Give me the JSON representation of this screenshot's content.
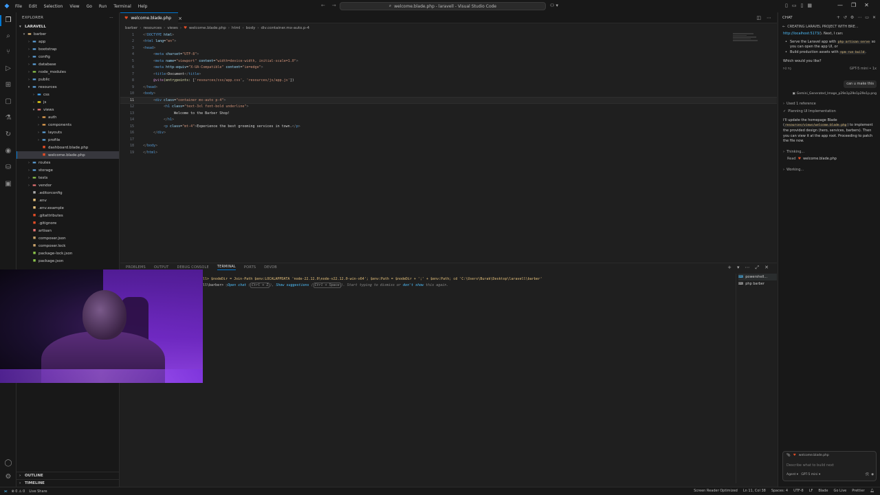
{
  "titlebar": {
    "menu": [
      "File",
      "Edit",
      "Selection",
      "View",
      "Go",
      "Run",
      "Terminal",
      "Help"
    ],
    "search_text": "welcome.blade.php - laravell - Visual Studio Code"
  },
  "explorer": {
    "header": "EXPLORER",
    "section": "LARAVELL",
    "items": [
      {
        "label": "barber",
        "depth": 1,
        "type": "folder-open",
        "icon_color": "#dcb67a"
      },
      {
        "label": "app",
        "depth": 2,
        "type": "folder",
        "icon_color": "#5ca0d8"
      },
      {
        "label": "bootstrap",
        "depth": 2,
        "type": "folder",
        "icon_color": "#5ca0d8"
      },
      {
        "label": "config",
        "depth": 2,
        "type": "folder",
        "icon_color": "#5ca0d8"
      },
      {
        "label": "database",
        "depth": 2,
        "type": "folder",
        "icon_color": "#5ca0d8"
      },
      {
        "label": "node_modules",
        "depth": 2,
        "type": "folder",
        "icon_color": "#8bc34a"
      },
      {
        "label": "public",
        "depth": 2,
        "type": "folder",
        "icon_color": "#5ca0d8"
      },
      {
        "label": "resources",
        "depth": 2,
        "type": "folder-open",
        "icon_color": "#5ca0d8"
      },
      {
        "label": "css",
        "depth": 3,
        "type": "folder",
        "icon_color": "#42a5f5"
      },
      {
        "label": "js",
        "depth": 3,
        "type": "folder",
        "icon_color": "#f5de19"
      },
      {
        "label": "views",
        "depth": 3,
        "type": "folder-open",
        "icon_color": "#e57373"
      },
      {
        "label": "auth",
        "depth": 4,
        "type": "folder",
        "icon_color": "#e5a050"
      },
      {
        "label": "components",
        "depth": 4,
        "type": "folder",
        "icon_color": "#e5a050"
      },
      {
        "label": "layouts",
        "depth": 4,
        "type": "folder",
        "icon_color": "#5ca0d8"
      },
      {
        "label": "profile",
        "depth": 4,
        "type": "folder",
        "icon_color": "#5ca0d8"
      },
      {
        "label": "dashboard.blade.php",
        "depth": 4,
        "type": "file",
        "icon_color": "#e44d26"
      },
      {
        "label": "welcome.blade.php",
        "depth": 4,
        "type": "file",
        "icon_color": "#e44d26",
        "selected": true
      },
      {
        "label": "routes",
        "depth": 2,
        "type": "folder",
        "icon_color": "#5ca0d8"
      },
      {
        "label": "storage",
        "depth": 2,
        "type": "folder",
        "icon_color": "#5ca0d8"
      },
      {
        "label": "tests",
        "depth": 2,
        "type": "folder",
        "icon_color": "#8bc34a"
      },
      {
        "label": "vendor",
        "depth": 2,
        "type": "folder",
        "icon_color": "#e57373"
      },
      {
        "label": ".editorconfig",
        "depth": 2,
        "type": "file",
        "icon_color": "#aaaaaa"
      },
      {
        "label": ".env",
        "depth": 2,
        "type": "file",
        "icon_color": "#e5c07b"
      },
      {
        "label": ".env.example",
        "depth": 2,
        "type": "file",
        "icon_color": "#e5c07b"
      },
      {
        "label": ".gitattributes",
        "depth": 2,
        "type": "file",
        "icon_color": "#e44d26"
      },
      {
        "label": ".gitignore",
        "depth": 2,
        "type": "file",
        "icon_color": "#e44d26"
      },
      {
        "label": "artisan",
        "depth": 2,
        "type": "file",
        "icon_color": "#e57373"
      },
      {
        "label": "composer.json",
        "depth": 2,
        "type": "file",
        "icon_color": "#c9a36b"
      },
      {
        "label": "composer.lock",
        "depth": 2,
        "type": "file",
        "icon_color": "#c9a36b"
      },
      {
        "label": "package-lock.json",
        "depth": 2,
        "type": "file",
        "icon_color": "#8bc34a"
      },
      {
        "label": "package.json",
        "depth": 2,
        "type": "file",
        "icon_color": "#8bc34a"
      }
    ],
    "outline": "OUTLINE",
    "timeline": "TIMELINE"
  },
  "tab": {
    "label": "welcome.blade.php"
  },
  "breadcrumb": [
    "barber",
    "resources",
    "views",
    "welcome.blade.php",
    "html",
    "body",
    "div.container.mx-auto.p-4"
  ],
  "code": [
    {
      "n": "1",
      "indent": 0,
      "parts": [
        [
          "punct",
          "<!"
        ],
        [
          "tag",
          "DOCTYPE"
        ],
        [
          "attr",
          " html"
        ],
        [
          "punct",
          ">"
        ]
      ]
    },
    {
      "n": "2",
      "indent": 0,
      "parts": [
        [
          "punct",
          "<"
        ],
        [
          "tag",
          "html"
        ],
        [
          "attr",
          " lang"
        ],
        [
          "txtc",
          "="
        ],
        [
          "str",
          "\"en\""
        ],
        [
          "punct",
          ">"
        ]
      ]
    },
    {
      "n": "3",
      "indent": 0,
      "parts": [
        [
          "punct",
          "<"
        ],
        [
          "tag",
          "head"
        ],
        [
          "punct",
          ">"
        ]
      ]
    },
    {
      "n": "4",
      "indent": 1,
      "parts": [
        [
          "punct",
          "<"
        ],
        [
          "tag",
          "meta"
        ],
        [
          "attr",
          " charset"
        ],
        [
          "txtc",
          "="
        ],
        [
          "str",
          "\"UTF-8\""
        ],
        [
          "punct",
          ">"
        ]
      ]
    },
    {
      "n": "5",
      "indent": 1,
      "parts": [
        [
          "punct",
          "<"
        ],
        [
          "tag",
          "meta"
        ],
        [
          "attr",
          " name"
        ],
        [
          "txtc",
          "="
        ],
        [
          "str",
          "\"viewport\""
        ],
        [
          "attr",
          " content"
        ],
        [
          "txtc",
          "="
        ],
        [
          "str",
          "\"width=device-width, initial-scale=1.0\""
        ],
        [
          "punct",
          ">"
        ]
      ]
    },
    {
      "n": "6",
      "indent": 1,
      "parts": [
        [
          "punct",
          "<"
        ],
        [
          "tag",
          "meta"
        ],
        [
          "attr",
          " http-equiv"
        ],
        [
          "txtc",
          "="
        ],
        [
          "str",
          "\"X-UA-Compatible\""
        ],
        [
          "attr",
          " content"
        ],
        [
          "txtc",
          "="
        ],
        [
          "str",
          "\"ie=edge\""
        ],
        [
          "punct",
          ">"
        ]
      ]
    },
    {
      "n": "7",
      "indent": 1,
      "parts": [
        [
          "punct",
          "<"
        ],
        [
          "tag",
          "title"
        ],
        [
          "punct",
          ">"
        ],
        [
          "txtc",
          "Document"
        ],
        [
          "punct",
          "</"
        ],
        [
          "tag",
          "title"
        ],
        [
          "punct",
          ">"
        ]
      ]
    },
    {
      "n": "8",
      "indent": 1,
      "parts": [
        [
          "kw",
          "@vite"
        ],
        [
          "fn",
          "(entrypoints: "
        ],
        [
          "txtc",
          "["
        ],
        [
          "str",
          "'resources/css/app.css'"
        ],
        [
          "txtc",
          ", "
        ],
        [
          "str",
          "'resources/js/app.js'"
        ],
        [
          "txtc",
          "])"
        ]
      ]
    },
    {
      "n": "9",
      "indent": 0,
      "parts": [
        [
          "punct",
          "</"
        ],
        [
          "tag",
          "head"
        ],
        [
          "punct",
          ">"
        ]
      ]
    },
    {
      "n": "10",
      "indent": 0,
      "parts": [
        [
          "punct",
          "<"
        ],
        [
          "tag",
          "body"
        ],
        [
          "punct",
          ">"
        ]
      ]
    },
    {
      "n": "11",
      "indent": 1,
      "current": true,
      "parts": [
        [
          "punct",
          "<"
        ],
        [
          "tag",
          "div"
        ],
        [
          "attr",
          " class"
        ],
        [
          "txtc",
          "="
        ],
        [
          "str",
          "\"container mx-auto p-4\""
        ],
        [
          "punct",
          ">"
        ]
      ]
    },
    {
      "n": "12",
      "indent": 2,
      "parts": [
        [
          "punct",
          "<"
        ],
        [
          "tag",
          "h1"
        ],
        [
          "attr",
          " class"
        ],
        [
          "txtc",
          "="
        ],
        [
          "str",
          "\"text-3xl font-bold underline\""
        ],
        [
          "punct",
          ">"
        ]
      ]
    },
    {
      "n": "13",
      "indent": 3,
      "parts": [
        [
          "txtc",
          "Welcome to the Barber Shop!"
        ]
      ]
    },
    {
      "n": "14",
      "indent": 2,
      "parts": [
        [
          "punct",
          "</"
        ],
        [
          "tag",
          "h1"
        ],
        [
          "punct",
          ">"
        ]
      ]
    },
    {
      "n": "15",
      "indent": 2,
      "parts": [
        [
          "punct",
          "<"
        ],
        [
          "tag",
          "p"
        ],
        [
          "attr",
          " class"
        ],
        [
          "txtc",
          "="
        ],
        [
          "str",
          "\"mt-4\""
        ],
        [
          "punct",
          ">"
        ],
        [
          "txtc",
          "Experience the best grooming services in town."
        ],
        [
          "punct",
          "</"
        ],
        [
          "tag",
          "p"
        ],
        [
          "punct",
          ">"
        ]
      ]
    },
    {
      "n": "16",
      "indent": 1,
      "parts": [
        [
          "punct",
          "</"
        ],
        [
          "tag",
          "div"
        ],
        [
          "punct",
          ">"
        ]
      ]
    },
    {
      "n": "17",
      "indent": 0,
      "parts": []
    },
    {
      "n": "18",
      "indent": 0,
      "parts": [
        [
          "punct",
          "</"
        ],
        [
          "tag",
          "body"
        ],
        [
          "punct",
          ">"
        ]
      ]
    },
    {
      "n": "19",
      "indent": 0,
      "parts": [
        [
          "punct",
          "</"
        ],
        [
          "tag",
          "html"
        ],
        [
          "punct",
          ">"
        ]
      ]
    }
  ],
  "panel": {
    "tabs": [
      "PROBLEMS",
      "OUTPUT",
      "DEBUG CONSOLE",
      "TERMINAL",
      "PORTS",
      "DEVDB"
    ],
    "active_tab": "TERMINAL",
    "terminal_line1": "ll> $nodeDir = Join-Path $env:LOCALAPPDATA 'node-22.12.0\\node-v22.12.0-win-x64'; $env:Path = $nodeDir + ';' + $env:Path; cd 'C:\\Users\\Burak\\Desktop\\laravell\\barber'",
    "terminal_line2_prefix": "ll\\barber> ",
    "terminal_hint_open": "Open chat",
    "terminal_hint_key1": "Ctrl + I",
    "terminal_hint_show": "Show suggestions",
    "terminal_hint_key2": "Ctrl + Space",
    "terminal_hint_rest": ". Start typing to dismiss or",
    "terminal_hint_dont": "don't show",
    "terminal_hint_end": "this again.",
    "terminals": [
      "powershell...",
      "php  barber"
    ]
  },
  "chat": {
    "header": "CHAT",
    "title": "CREATING LARAVEL PROJECT WITH BRE...",
    "intro_link": "http://localhost:5173/",
    "intro_rest": "). Next, I can:",
    "bullet1_a": "Serve the Laravel app with",
    "bullet1_code": "php artisan serve",
    "bullet1_b": "so you can open the app UI, or",
    "bullet2_a": "Build production assets with",
    "bullet2_code": "npm run build",
    "question": "Which would you like?",
    "model_meta": "GPT-5 mini • 1x",
    "user_msg": "can u make this",
    "attachment": "Gemini_Generated_Image_p29e1p29e1p29e1p.png",
    "used_ref": "Used 1 reference",
    "planning": "Planning UI Implementation",
    "response_a": "I'll update the homepage Blade (",
    "response_code": "resources/views/welcome.blade.php",
    "response_b": ") to implement the provided design (hero, services, barbers). Then you can view it at the app root. Proceeding to patch the file now.",
    "thinking": "Thinking...",
    "read_label": "Read",
    "read_file": "welcome.blade.php",
    "working": "Working...",
    "composer_ctx": "welcome.blade.php",
    "composer_placeholder": "Describe what to build next",
    "agent_label": "Agent",
    "model_label": "GPT-5 mini"
  },
  "status": {
    "left": [
      "⊗ 0  ⚠ 0",
      "Live Share"
    ],
    "right": [
      "Screen Reader Optimized",
      "Ln 11, Col 38",
      "Spaces: 4",
      "UTF-8",
      "LF",
      "Blade",
      "Go Live",
      "Prettier"
    ]
  }
}
